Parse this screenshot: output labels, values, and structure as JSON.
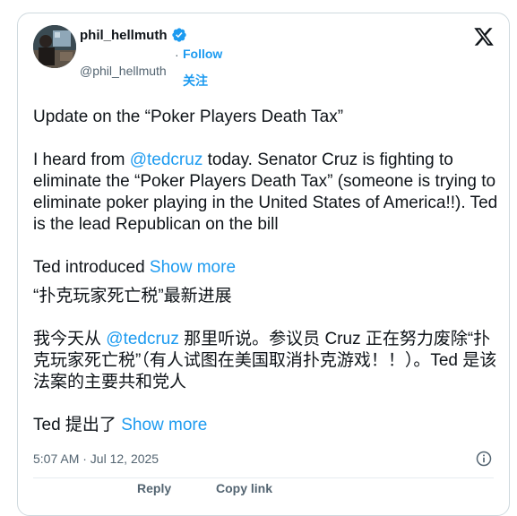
{
  "author": {
    "name": "phil_hellmuth",
    "handle": "@phil_hellmuth",
    "follow_separator": "·",
    "follow_label": "Follow",
    "follow_label_cn": "关注"
  },
  "tweet": {
    "line1": "Update on the “Poker Players Death Tax”",
    "para2_before": "I heard from ",
    "para2_mention": "@tedcruz",
    "para2_after": " today. Senator Cruz is fighting to eliminate the “Poker Players Death Tax” (someone is trying to eliminate poker playing in the United States of America!!). Ted is the lead Republican on the bill",
    "para3_before": "Ted introduced ",
    "para3_show_more": "Show more",
    "cn_line1": "“扑克玩家死亡税”最新进展",
    "cn_para2_before": "我今天从 ",
    "cn_para2_mention": "@tedcruz",
    "cn_para2_after": " 那里听说。参议员 Cruz 正在努力废除“扑克玩家死亡税”（有人试图在美国取消扑克游戏！！）。Ted 是该法案的主要共和党人",
    "cn_para3_before": "Ted 提出了 ",
    "cn_para3_show_more": "Show more"
  },
  "timestamp": "5:07 AM · Jul 12, 2025",
  "actions": {
    "reply": "Reply",
    "copy_link": "Copy link"
  },
  "colors": {
    "accent": "#1d9bf0",
    "text": "#0f1419",
    "muted": "#536471"
  },
  "icons": {
    "verified": "verified-badge-icon",
    "x_logo": "x-logo-icon",
    "info": "info-icon"
  }
}
